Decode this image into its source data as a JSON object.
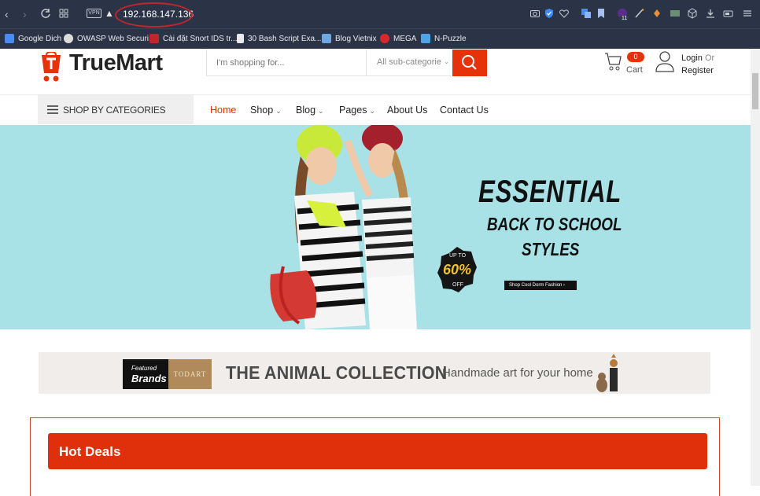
{
  "browser": {
    "url": "192.168.147.136",
    "vpn_label": "VPN",
    "extension_badge": "11",
    "bookmarks": [
      {
        "label": "Google Dich",
        "icon": "translate-icon",
        "color": "#4a8af4"
      },
      {
        "label": "OWASP Web Securi...",
        "icon": "owasp-icon",
        "color": "#dcdcdc"
      },
      {
        "label": "Cài đặt Snort IDS tr...",
        "icon": "n-logo-icon",
        "color": "#c0262c"
      },
      {
        "label": "30 Bash Script Exa...",
        "icon": "document-icon",
        "color": "#e8eaed"
      },
      {
        "label": "Blog Vietnix",
        "icon": "cube-stack-icon",
        "color": "#6fa7e0"
      },
      {
        "label": "MEGA",
        "icon": "mega-icon",
        "color": "#d9272e"
      },
      {
        "label": "N-Puzzle",
        "icon": "t-logo-icon",
        "color": "#4da3e6"
      }
    ]
  },
  "site": {
    "logo_text": "TrueMart",
    "search": {
      "placeholder": "I'm shopping for...",
      "category": "All sub-categorie"
    },
    "cart": {
      "count": "0",
      "label": "Cart"
    },
    "account": {
      "login": "Login",
      "or": "Or",
      "register": "Register"
    },
    "categories_label": "SHOP BY CATEGORIES",
    "nav": [
      {
        "label": "Home",
        "dropdown": false,
        "active": true
      },
      {
        "label": "Shop",
        "dropdown": true,
        "active": false
      },
      {
        "label": "Blog",
        "dropdown": true,
        "active": false
      },
      {
        "label": "Pages",
        "dropdown": true,
        "active": false
      },
      {
        "label": "About Us",
        "dropdown": false,
        "active": false
      },
      {
        "label": "Contact Us",
        "dropdown": false,
        "active": false
      }
    ],
    "banner": {
      "headline": "ESSENTIAL",
      "line2": "BACK TO SCHOOL",
      "line3": "STYLES",
      "badge_top": "UP TO",
      "badge_value": "60%",
      "badge_bottom": "OFF",
      "cta": "Shop Cool Dorm Fashion ›",
      "bg_color": "#a8e2e6"
    },
    "brands": {
      "featured_a": "Featured",
      "featured_b": "Brands",
      "brand_logo": "TODART",
      "title": "THE ANIMAL COLLECTION",
      "subtitle": "Handmade art for your home"
    },
    "hot_deals": "Hot Deals",
    "accent_color": "#e5320a"
  }
}
